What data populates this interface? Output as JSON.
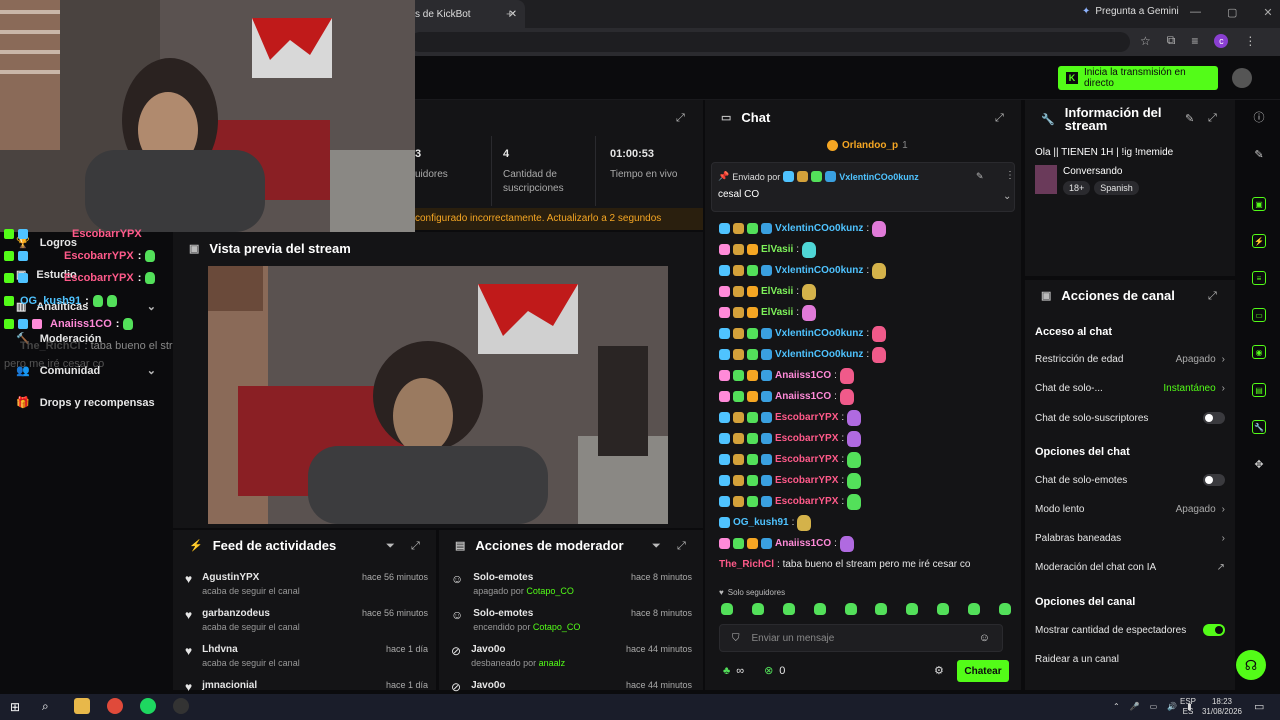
{
  "browser": {
    "tab_title": "s de KickBot",
    "gemini_label": "Pregunta a Gemini",
    "profile_initial": "c"
  },
  "header": {
    "go_live_label": "Inicia la transmisión en directo"
  },
  "left_nav": {
    "items": [
      {
        "label": "Logros"
      },
      {
        "label": "Estudio"
      },
      {
        "label": "Analíticas"
      },
      {
        "label": "Moderación"
      },
      {
        "label": "Comunidad"
      },
      {
        "label": "Drops y recompensas"
      }
    ]
  },
  "overlay_chat": {
    "lines": [
      {
        "user": "EscobarrYPX"
      },
      {
        "user": "EscobarrYPX"
      },
      {
        "user": "EscobarrYPX"
      },
      {
        "user": "OG_kush91"
      },
      {
        "user": "Anaiiss1CO"
      }
    ],
    "last_user": "The_RichCl",
    "last_text": ": taba bueno el stream",
    "last_text2": "pero me iré cesar co"
  },
  "stats": {
    "followers_num": "3",
    "followers_label": "uidores",
    "subs_num": "4",
    "subs_label": "Cantidad de suscripciones",
    "time_num": "01:00:53",
    "time_label": "Tiempo en vivo",
    "alert": "configurado incorrectamente. Actualizarlo a 2 segundos"
  },
  "preview": {
    "title": "Vista previa del stream"
  },
  "activity_feed": {
    "title": "Feed de actividades",
    "items": [
      {
        "name": "AgustinYPX",
        "sub": "acaba de seguir el canal",
        "time": "hace 56 minutos"
      },
      {
        "name": "garbanzodeus",
        "sub": "acaba de seguir el canal",
        "time": "hace 56 minutos"
      },
      {
        "name": "Lhdvna",
        "sub": "acaba de seguir el canal",
        "time": "hace 1 día"
      },
      {
        "name": "jmnacionial",
        "sub": "",
        "time": "hace 1 día"
      }
    ]
  },
  "mod_actions": {
    "title": "Acciones de moderador",
    "items": [
      {
        "name": "Solo-emotes",
        "sub": "apagado por",
        "by": "Cotapo_CO",
        "time": "hace 8 minutos"
      },
      {
        "name": "Solo-emotes",
        "sub": "encendido por",
        "by": "Cotapo_CO",
        "time": "hace 8 minutos"
      },
      {
        "name": "Javo0o",
        "sub": "desbaneado por",
        "by": "anaalz",
        "time": "hace 44 minutos"
      },
      {
        "name": "Javo0o",
        "sub": "",
        "by": "",
        "time": "hace 44 minutos"
      }
    ]
  },
  "chat": {
    "title": "Chat",
    "top_user": "Orlandoo_p",
    "top_count": "1",
    "pinned_by_label": "Enviado por",
    "pinned_user": "VxlentinCOo0kunz",
    "pinned_text": "cesal CO",
    "messages": [
      {
        "user": "VxlentinCOo0kunz",
        "color": "#4fc3ff",
        "text": ":",
        "emote": "#e07ad8"
      },
      {
        "user": "ElVasii",
        "color": "#7ef25a",
        "text": ":",
        "emote": "#4fd6d6"
      },
      {
        "user": "VxlentinCOo0kunz",
        "color": "#4fc3ff",
        "text": ":",
        "emote": "#d4b24a"
      },
      {
        "user": "ElVasii",
        "color": "#7ef25a",
        "text": ":",
        "emote": "#d4b24a"
      },
      {
        "user": "ElVasii",
        "color": "#7ef25a",
        "text": ":",
        "emote": "#e07ad8"
      },
      {
        "user": "VxlentinCOo0kunz",
        "color": "#4fc3ff",
        "text": ":",
        "emote": "#f05a8a"
      },
      {
        "user": "VxlentinCOo0kunz",
        "color": "#4fc3ff",
        "text": ":",
        "emote": "#f05a8a"
      },
      {
        "user": "Anaiiss1CO",
        "color": "#ff8ad8",
        "text": ":",
        "emote": "#f05a8a"
      },
      {
        "user": "Anaiiss1CO",
        "color": "#ff8ad8",
        "text": ":",
        "emote": "#f05a8a"
      },
      {
        "user": "EscobarrYPX",
        "color": "#ff5a8a",
        "text": ":",
        "emote": "#b06ae0"
      },
      {
        "user": "EscobarrYPX",
        "color": "#ff5a8a",
        "text": ":",
        "emote": "#b06ae0"
      },
      {
        "user": "EscobarrYPX",
        "color": "#ff5a8a",
        "text": ":",
        "emote": "#53e05a"
      },
      {
        "user": "EscobarrYPX",
        "color": "#ff5a8a",
        "text": ":",
        "emote": "#53e05a"
      },
      {
        "user": "EscobarrYPX",
        "color": "#ff5a8a",
        "text": ":",
        "emote": "#53e05a"
      },
      {
        "user": "OG_kush91",
        "color": "#4fc3ff",
        "text": ":",
        "emote": "#d4b24a"
      },
      {
        "user": "Anaiiss1CO",
        "color": "#ff8ad8",
        "text": ":",
        "emote": "#b06ae0"
      },
      {
        "user": "The_RichCl",
        "color": "#ff5a8a",
        "text": ": taba bueno el stream pero me iré cesar co",
        "emote": ""
      }
    ],
    "followers_only": "Solo seguidores",
    "input_placeholder": "Enviar un mensaje",
    "points": "∞",
    "kicks": "0",
    "send_label": "Chatear"
  },
  "stream_info": {
    "title": "Información del stream",
    "stream_title": "Ola || TIENEN 1H | !ig !memide",
    "category": "Conversando",
    "tag_age": "18+",
    "tag_lang": "Spanish"
  },
  "channel_actions": {
    "title": "Acciones de canal",
    "chat_access": "Acceso al chat",
    "age_restriction": "Restricción de edad",
    "age_restriction_val": "Apagado",
    "chat_only": "Chat de solo-...",
    "chat_only_val": "Instantáneo",
    "subs_only": "Chat de solo-suscriptores",
    "chat_options": "Opciones del chat",
    "emote_only": "Chat de solo-emotes",
    "slow_mode": "Modo lento",
    "slow_mode_val": "Apagado",
    "banned_words": "Palabras baneadas",
    "ai_moderation": "Moderación del chat con IA",
    "channel_options": "Opciones del canal",
    "show_viewers": "Mostrar cantidad de espectadores",
    "raid": "Raidear a un canal"
  },
  "taskbar": {
    "lang1": "ESP",
    "lang2": "ES",
    "time": "18:23",
    "date": "31/08/2026"
  },
  "colors": {
    "accent": "#53fc18",
    "panel": "#141416",
    "bg": "#0b0b0d"
  }
}
